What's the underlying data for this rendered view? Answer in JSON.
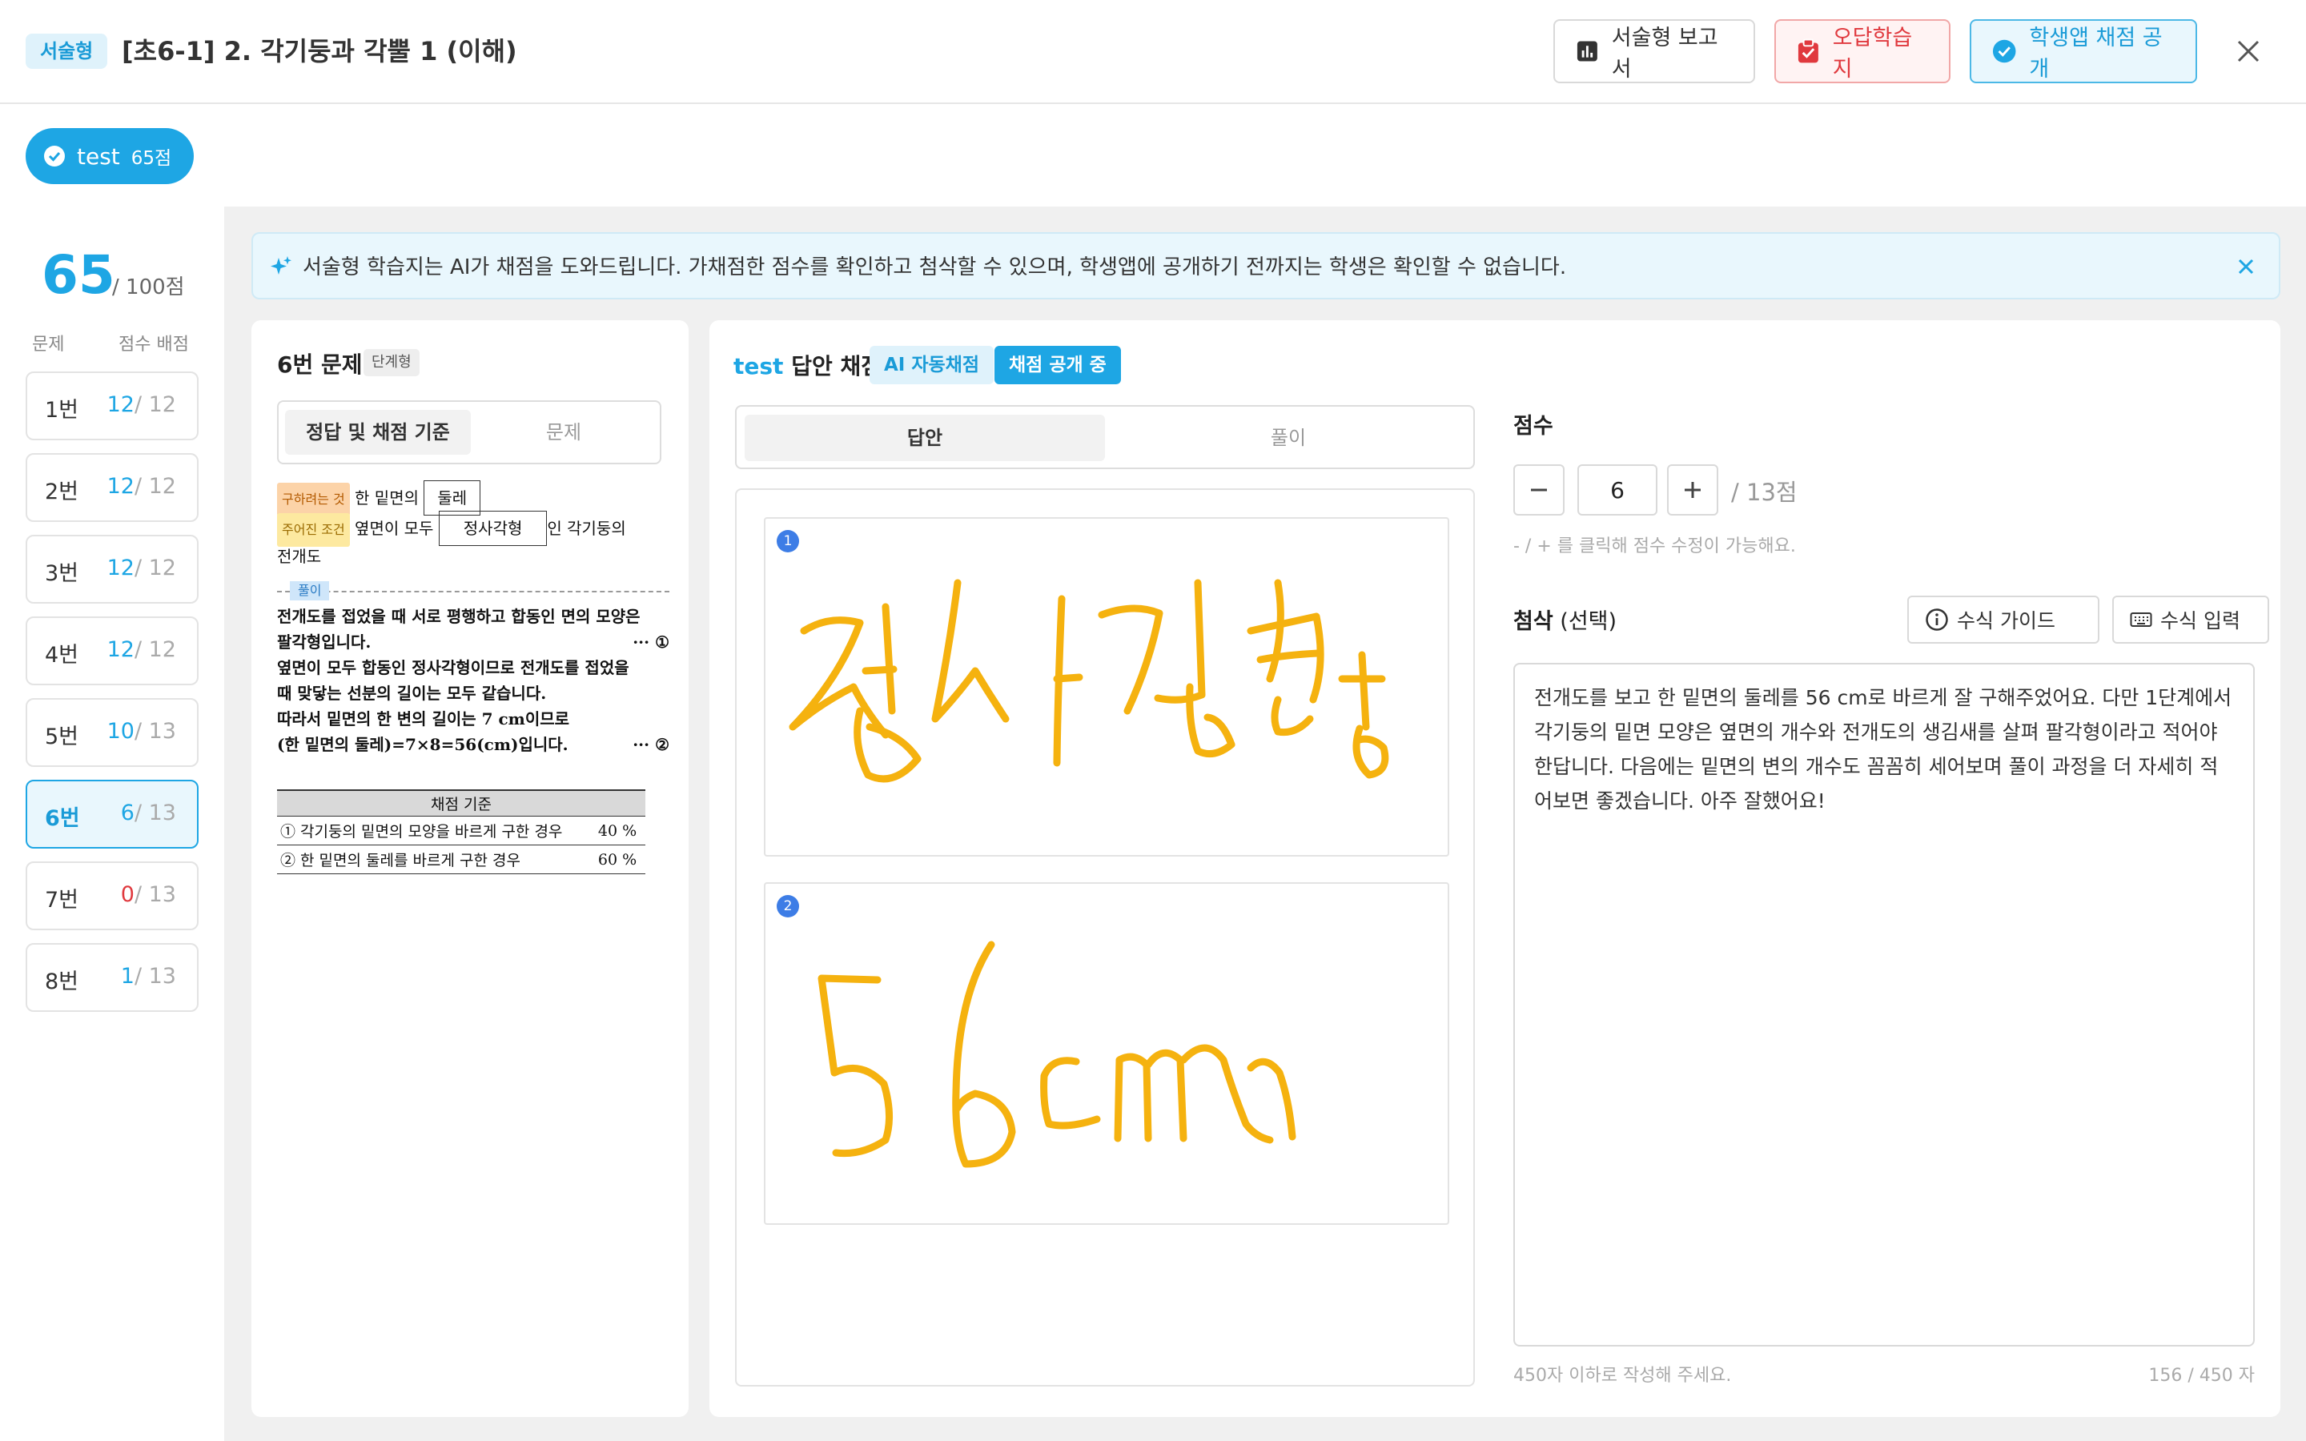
{
  "header": {
    "type_badge": "서술형",
    "title": "[초6-1] 2. 각기둥과 각뿔 1 (이해)",
    "report_button": "서술형 보고서",
    "wrong_note_button": "오답학습지",
    "publish_button": "학생앱 채점 공개",
    "colors": {
      "accent": "#1ea6e4",
      "danger": "#e0393e"
    }
  },
  "student": {
    "name": "test",
    "score": "65점"
  },
  "sidebar": {
    "total_score": "65",
    "total_max": "/ 100점",
    "col_question": "문제",
    "col_score": "점수 배점",
    "items": [
      {
        "name": "1번",
        "got": "12",
        "max": "/ 12"
      },
      {
        "name": "2번",
        "got": "12",
        "max": "/ 12"
      },
      {
        "name": "3번",
        "got": "12",
        "max": "/ 12"
      },
      {
        "name": "4번",
        "got": "12",
        "max": "/ 12"
      },
      {
        "name": "5번",
        "got": "10",
        "max": "/ 13"
      },
      {
        "name": "6번",
        "got": "6",
        "max": "/ 13"
      },
      {
        "name": "7번",
        "got": "0",
        "max": "/ 13"
      },
      {
        "name": "8번",
        "got": "1",
        "max": "/ 13"
      }
    ]
  },
  "banner": {
    "text": "서술형 학습지는 AI가 채점을 도와드립니다. 가채점한 점수를 확인하고 첨삭할 수 있으며, 학생앱에 공개하기 전까지는 학생은 확인할 수 없습니다."
  },
  "problem": {
    "title": "6번 문제",
    "badge": "단계형",
    "tab_answer": "정답 및 채점 기준",
    "tab_problem": "문제",
    "find_tag": "구하려는 것",
    "find_prefix": "한 밑면의",
    "find_box": "둘레",
    "cond_tag": "주어진 조건",
    "cond_prefix": "옆면이 모두",
    "cond_box": "정사각형",
    "cond_suffix": "인 각기둥의",
    "cond_line2": "전개도",
    "sol_tag": "풀이",
    "sol_lines": [
      "전개도를 접었을 때 서로 평행하고 합동인 면의 모양은",
      "팔각형입니다.",
      "옆면이 모두 합동인 정사각형이므로 전개도를 접었을",
      "때 맞닿는 선분의 길이는 모두 같습니다.",
      "따라서 밑면의 한 변의 길이는 7 cm이므로",
      "(한 밑면의 둘레)=7×8=56(cm)입니다."
    ],
    "sol_mark1": "··· ①",
    "sol_mark2": "··· ②",
    "criteria_header": "채점 기준",
    "criteria": [
      {
        "desc": "① 각기둥의 밑면의 모양을 바르게 구한 경우",
        "pct": "40 %"
      },
      {
        "desc": "② 한 밑면의 둘레를 바르게 구한 경우",
        "pct": "60 %"
      }
    ]
  },
  "grading": {
    "student_name": "test",
    "title_suffix": "답안 채점",
    "ai_tag": "AI 자동채점",
    "published_tag": "채점 공개 중",
    "tab_answer": "답안",
    "tab_solution": "풀이",
    "answer_numbers": [
      "1",
      "2"
    ],
    "score_label": "점수",
    "score_value": "6",
    "score_max": "/ 13점",
    "score_hint": "- / + 를 클릭해 점수 수정이 가능해요.",
    "comment_label": "첨삭",
    "comment_optional": "(선택)",
    "formula_guide": "수식 가이드",
    "formula_input": "수식 입력",
    "comment_text": "전개도를 보고 한 밑면의 둘레를 56 cm로 바르게 잘 구해주었어요. 다만 1단계에서 각기둥의 밑면 모양은 옆면의 개수와 전개도의 생김새를 살펴 팔각형이라고 적어야 한답니다. 다음에는 밑면의 변의 개수도 꼼꼼히 세어보며 풀이 과정을 더 자세히 적어보면 좋겠습니다. 아주 잘했어요!",
    "comment_hint": "450자 이하로 작성해 주세요.",
    "comment_count": "156 / 450 자",
    "ink_color": "#f5b20f"
  }
}
